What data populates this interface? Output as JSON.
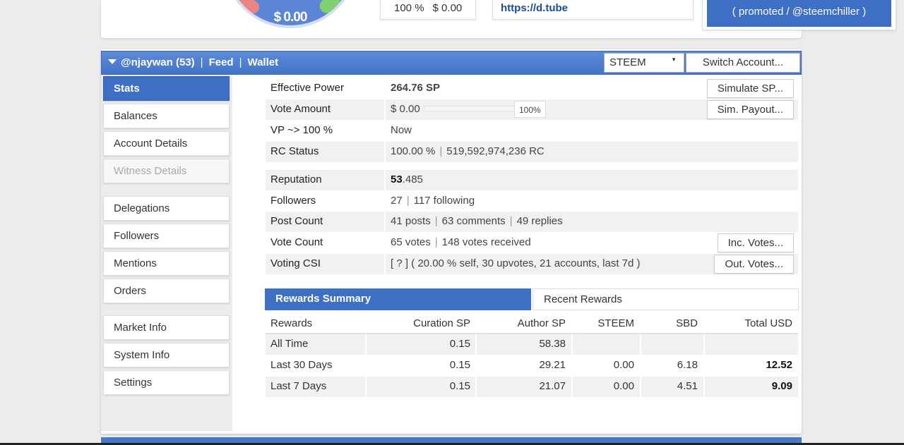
{
  "top": {
    "gauge_value": "$ 0.00",
    "vote_percent": "100 %",
    "vote_value": "$ 0.00",
    "url": "https://d.tube",
    "promoted": "( promoted / @steemchiller )"
  },
  "header": {
    "account": "@njaywan (53)",
    "sep": "|",
    "feed": "Feed",
    "wallet": "Wallet",
    "currency": "STEEM",
    "switch_account": "Switch Account..."
  },
  "sidebar": {
    "items": [
      {
        "label": "Stats",
        "state": "active"
      },
      {
        "label": "Balances"
      },
      {
        "label": "Account Details"
      },
      {
        "label": "Witness Details",
        "state": "disabled"
      },
      {
        "label": "Delegations"
      },
      {
        "label": "Followers"
      },
      {
        "label": "Mentions"
      },
      {
        "label": "Orders"
      },
      {
        "label": "Market Info"
      },
      {
        "label": "System Info"
      },
      {
        "label": "Settings"
      }
    ]
  },
  "stats": {
    "effective_power": {
      "label": "Effective Power",
      "value": "264.76 SP",
      "button": "Simulate SP..."
    },
    "vote_amount": {
      "label": "Vote Amount",
      "value": "$ 0.00",
      "percent": "100%",
      "level": 1.0,
      "button": "Sim. Payout..."
    },
    "vp": {
      "label": "VP ~> 100 %",
      "value": "Now"
    },
    "rc": {
      "label": "RC Status",
      "percent": "100.00 %",
      "amount": "519,592,974,236 RC"
    },
    "reputation": {
      "label": "Reputation",
      "int": "53",
      "dec": ".485"
    },
    "followers": {
      "label": "Followers",
      "count": "27",
      "following": "117 following"
    },
    "post_count": {
      "label": "Post Count",
      "posts": "41 posts",
      "comments": "63 comments",
      "replies": "49 replies"
    },
    "vote_count": {
      "label": "Vote Count",
      "votes": "65 votes",
      "received": "148 votes received",
      "button": "Inc. Votes..."
    },
    "voting_csi": {
      "label": "Voting CSI",
      "value": "[ ? ] ( 20.00 % self, 30 upvotes, 21 accounts, last 7d )",
      "button": "Out. Votes..."
    }
  },
  "rewards": {
    "tab_summary": "Rewards Summary",
    "tab_recent": "Recent Rewards",
    "headers": [
      "Rewards",
      "Curation SP",
      "Author SP",
      "STEEM",
      "SBD",
      "Total USD"
    ],
    "rows": [
      [
        "All Time",
        "0.15",
        "58.38",
        "",
        "",
        ""
      ],
      [
        "Last 30 Days",
        "0.15",
        "29.21",
        "0.00",
        "6.18",
        "12.52"
      ],
      [
        "Last 7 Days",
        "0.15",
        "21.07",
        "0.00",
        "4.51",
        "9.09"
      ]
    ]
  },
  "colors": {
    "accent": "#3d6fc4",
    "header": "#4e7fd0"
  }
}
